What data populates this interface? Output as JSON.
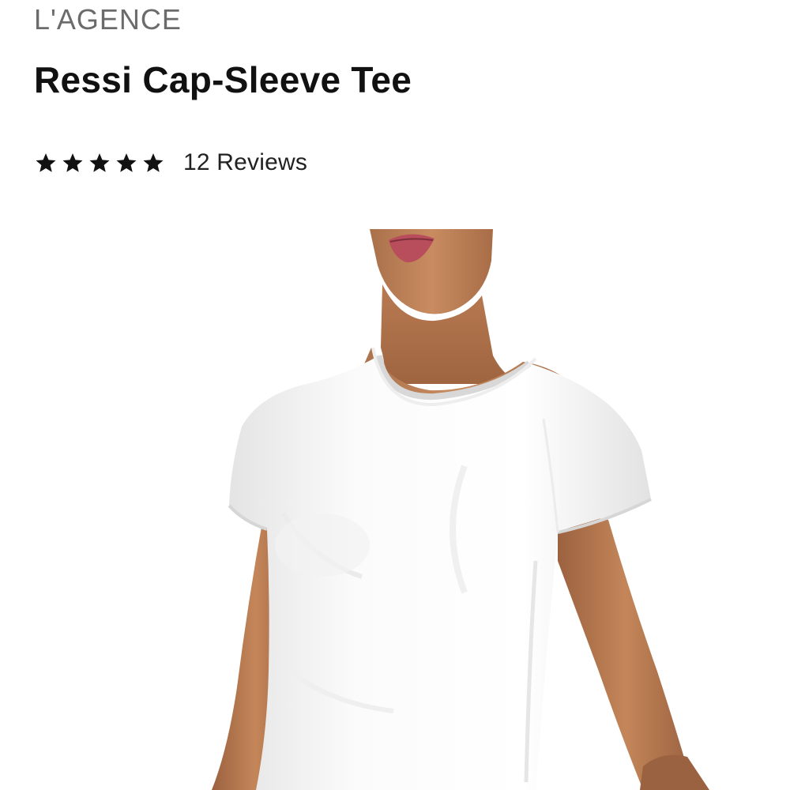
{
  "product": {
    "brand": "L'AGENCE",
    "name": "Ressi Cap-Sleeve Tee",
    "rating": {
      "value": 5,
      "max": 5,
      "reviews_label": "12 Reviews"
    }
  },
  "colors": {
    "brand_text": "#6b6b6b",
    "title_text": "#111111",
    "star_fill": "#111111"
  },
  "icons": {
    "star": "star-icon"
  }
}
